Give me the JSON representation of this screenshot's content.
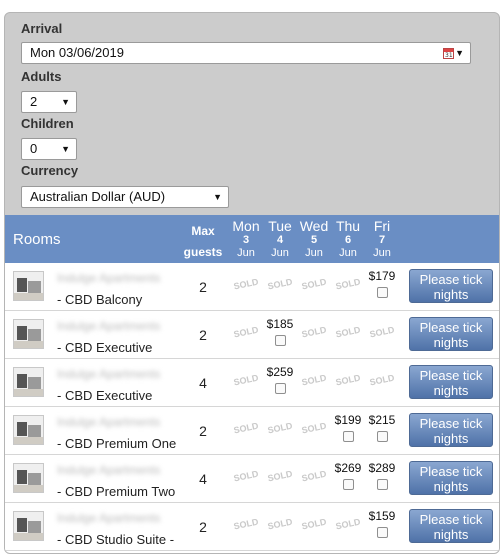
{
  "form": {
    "arrival_label": "Arrival",
    "arrival_value": "Mon 03/06/2019",
    "adults_label": "Adults",
    "adults_value": "2",
    "children_label": "Children",
    "children_value": "0",
    "currency_label": "Currency",
    "currency_value": "Australian Dollar (AUD)"
  },
  "table": {
    "rooms_header": "Rooms",
    "max_header_1": "Max",
    "max_header_2": "guests",
    "days": [
      {
        "name": "Mon",
        "date": "3",
        "month": "Jun"
      },
      {
        "name": "Tue",
        "date": "4",
        "month": "Jun"
      },
      {
        "name": "Wed",
        "date": "5",
        "month": "Jun"
      },
      {
        "name": "Thu",
        "date": "6",
        "month": "Jun"
      },
      {
        "name": "Fri",
        "date": "7",
        "month": "Jun"
      }
    ],
    "sold_text": "SOLD",
    "rows": [
      {
        "property": "Indulge Apartments",
        "name": "- CBD Balcony",
        "max": "2",
        "cells": [
          "SOLD",
          "SOLD",
          "SOLD",
          "SOLD",
          "$179"
        ],
        "button": "Please tick nights"
      },
      {
        "property": "Indulge Apartments",
        "name": "- CBD Executive",
        "max": "2",
        "cells": [
          "SOLD",
          "$185",
          "SOLD",
          "SOLD",
          "SOLD"
        ],
        "button": "Please tick nights"
      },
      {
        "property": "Indulge Apartments",
        "name": "- CBD Executive",
        "max": "4",
        "cells": [
          "SOLD",
          "$259",
          "SOLD",
          "SOLD",
          "SOLD"
        ],
        "button": "Please tick nights"
      },
      {
        "property": "Indulge Apartments",
        "name": "- CBD Premium One",
        "max": "2",
        "cells": [
          "SOLD",
          "SOLD",
          "SOLD",
          "$199",
          "$215"
        ],
        "button": "Please tick nights"
      },
      {
        "property": "Indulge Apartments",
        "name": "- CBD Premium Two",
        "max": "4",
        "cells": [
          "SOLD",
          "SOLD",
          "SOLD",
          "$269",
          "$289"
        ],
        "button": "Please tick nights"
      },
      {
        "property": "Indulge Apartments",
        "name": "- CBD Studio Suite -",
        "max": "2",
        "cells": [
          "SOLD",
          "SOLD",
          "SOLD",
          "SOLD",
          "$159"
        ],
        "button": "Please tick nights"
      }
    ]
  }
}
